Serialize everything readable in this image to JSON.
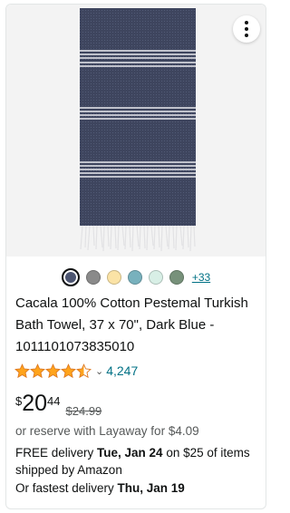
{
  "product": {
    "title": "Cacala 100% Cotton Pestemal Turkish Bath Towel, 37 x 70\", Dark Blue - 1011101073835010",
    "rating_value": 4.5,
    "rating_count": "4,247",
    "price_symbol": "$",
    "price_whole": "20",
    "price_fraction": "44",
    "list_price": "$24.99",
    "layaway": "or reserve with Layaway for $4.09",
    "delivery_prefix": "FREE delivery ",
    "delivery_date": "Tue, Jan 24",
    "delivery_suffix": " on $25 of items shipped by Amazon",
    "fastest_prefix": "Or fastest delivery ",
    "fastest_date": "Thu, Jan 19"
  },
  "swatches": {
    "colors": [
      "#4c5571",
      "#8a8a8a",
      "#fbe3a6",
      "#78b1bd",
      "#d8efe6",
      "#77917a"
    ],
    "selected_index": 0,
    "more_label": "+33"
  },
  "colors": {
    "towel": "#3e455e",
    "link": "#007185",
    "star": "#ffa41c"
  },
  "icons": {
    "menu": "kebab-menu-icon",
    "rating_dropdown": "chevron-down-icon"
  }
}
